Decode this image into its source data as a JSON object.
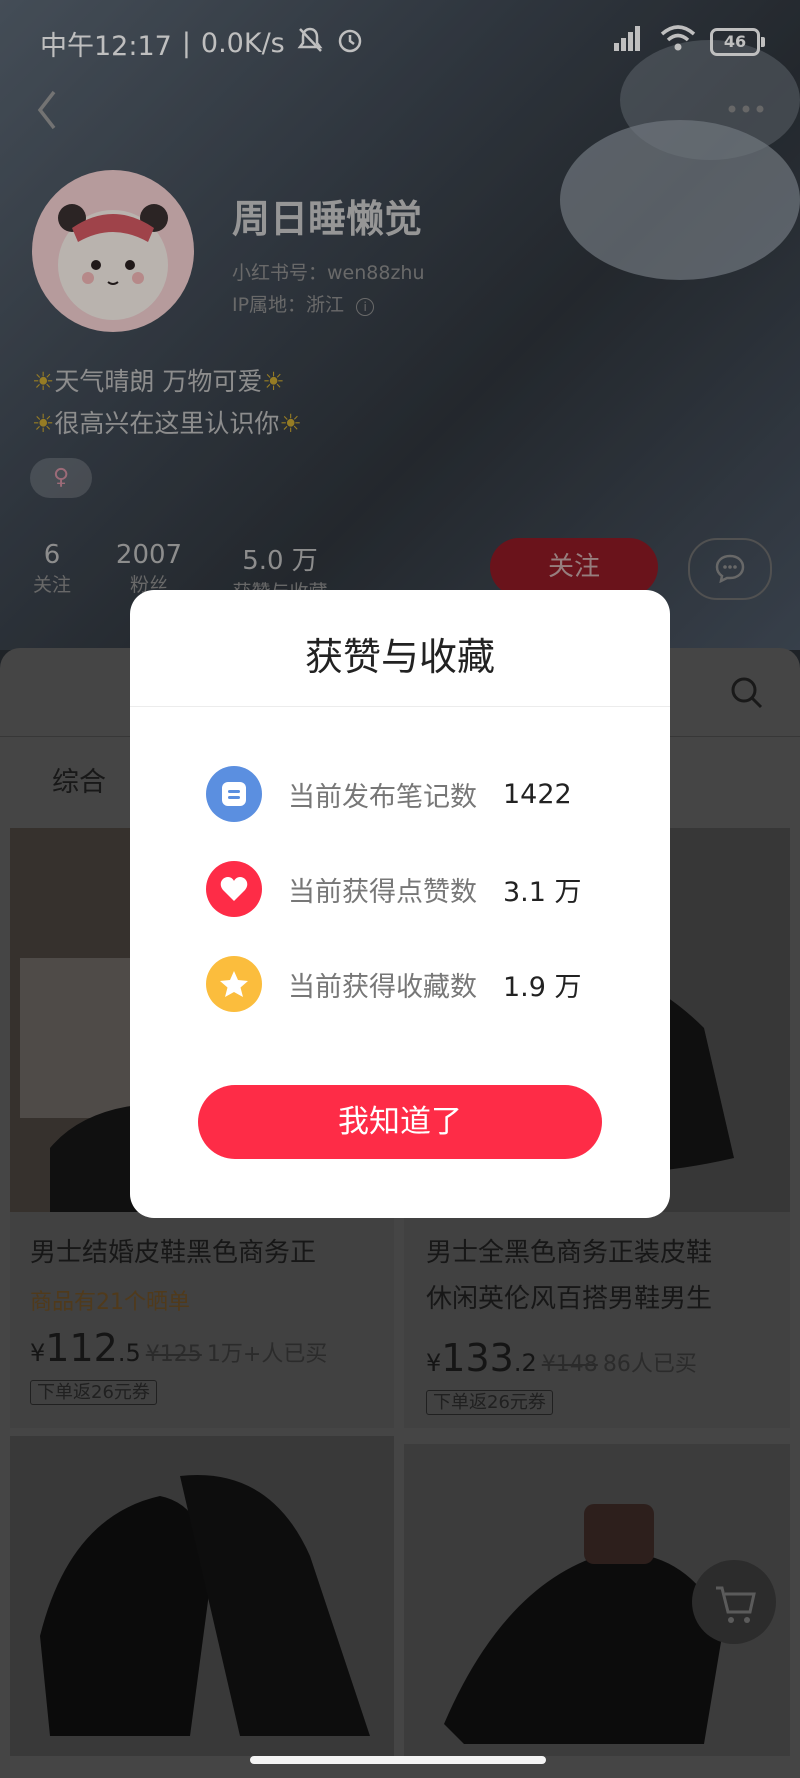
{
  "status_bar": {
    "time": "中午12:17",
    "speed": "0.0K/s",
    "battery": "46"
  },
  "profile": {
    "username": "周日睡懒觉",
    "red_id": "小红书号：wen88zhu",
    "ip_location": "IP属地：浙江",
    "bio_line1": "天气晴朗 万物可爱",
    "bio_line2": "很高兴在这里认识你",
    "gender_symbol": "♀",
    "stats": [
      {
        "value": "6",
        "label": "关注"
      },
      {
        "value": "2007",
        "label": "粉丝"
      },
      {
        "value": "5.0 万",
        "label": "获赞与收藏"
      }
    ],
    "follow_label": "关注"
  },
  "tabs": {
    "all_label": "综合"
  },
  "products": [
    {
      "title": "男士结婚皮鞋黑色商务正",
      "subtitle": "商品有21个晒单",
      "price_int": "112",
      "price_dec": ".5",
      "old_price": "¥125",
      "sold": "1万+人已买",
      "coupon": "下单返26元券"
    },
    {
      "title_line1": "男士全黑色商务正装皮鞋",
      "title_line2": "休闲英伦风百搭男鞋男生",
      "price_int": "133",
      "price_dec": ".2",
      "old_price": "¥148",
      "sold": "86人已买",
      "coupon": "下单返26元券"
    }
  ],
  "currency": "¥",
  "modal": {
    "title": "获赞与收藏",
    "rows": [
      {
        "label": "当前发布笔记数",
        "value": "1422",
        "icon": "note-icon",
        "color": "#5b8fe0"
      },
      {
        "label": "当前获得点赞数",
        "value": "3.1 万",
        "icon": "heart-icon",
        "color": "#fe2c47"
      },
      {
        "label": "当前获得收藏数",
        "value": "1.9 万",
        "icon": "star-icon",
        "color": "#fbbd3d"
      }
    ],
    "confirm_label": "我知道了"
  }
}
